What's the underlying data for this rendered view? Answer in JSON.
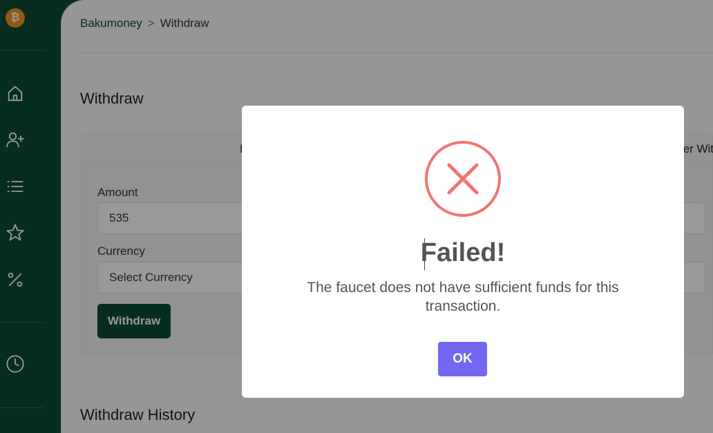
{
  "sidebar": {
    "logo_glyph": "₿",
    "icons": [
      "home-icon",
      "add-user-icon",
      "list-icon",
      "star-icon",
      "percent-icon",
      "clock-icon"
    ]
  },
  "breadcrumb": {
    "root": "Bakumoney",
    "separator": ">",
    "current": "Withdraw"
  },
  "page": {
    "withdraw_heading": "Withdraw",
    "tabs": {
      "left": "Fa",
      "right": "er Wit"
    },
    "amount_label": "Amount",
    "amount_value": "535",
    "currency_label": "Currency",
    "currency_value": "Select Currency",
    "withdraw_button": "Withdraw",
    "history_heading": "Withdraw History"
  },
  "modal": {
    "title": "Failed!",
    "message": "The faucet does not have sufficient funds for this transaction.",
    "ok_button": "OK",
    "icon": "error-x-circle-icon"
  },
  "colors": {
    "sidebar": "#0d4a36",
    "error_red": "#f27474",
    "ok_purple": "#7367f0",
    "btc_orange": "#f7931a"
  }
}
